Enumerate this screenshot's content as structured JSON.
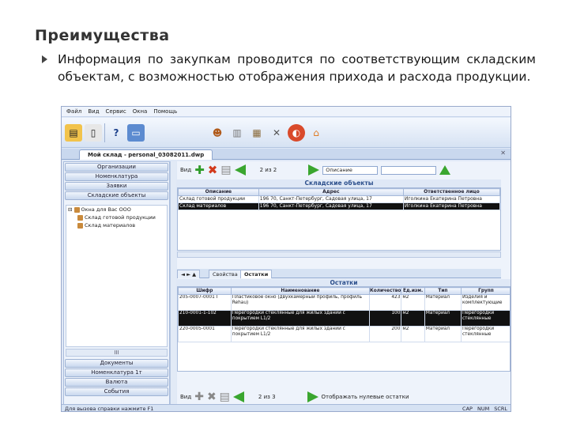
{
  "slide": {
    "title": "Преимущества",
    "bullet": "Информация по закупкам проводится по соответствующим складским объектам, с возможностью отображения прихода и расхода продукции."
  },
  "app": {
    "menu": [
      "Файл",
      "Вид",
      "Сервис",
      "Окна",
      "Помощь"
    ],
    "doc_tab": "Мой склад - personal_03082011.dwp",
    "sidebar": {
      "top_buttons": [
        "Организации",
        "Номенклатура",
        "Заявки",
        "Складские объекты"
      ],
      "tree": [
        "Окна для Вас ООО",
        "Склад готовой продукции",
        "Склад материалов"
      ],
      "scroll_label": "III",
      "bottom_buttons": [
        "Документы",
        "Номенклатура 1т",
        "Валюта",
        "События"
      ]
    },
    "top_toolbar": {
      "view_label": "Вид",
      "page": "2 из 2",
      "filter": "Описание"
    },
    "objects_grid": {
      "title": "Складские объекты",
      "columns": [
        "Описание",
        "Адрес",
        "Ответственное лицо"
      ],
      "rows": [
        [
          "Склад готовой продукции",
          "196 70, Санкт-Петербург, Садовая улица, 17",
          "Иголкина Екатерина Петровна"
        ],
        [
          "Склад материалов",
          "196 70, Санкт-Петербург, Садовая улица, 17",
          "Иголкина Екатерина Петровна"
        ]
      ],
      "selected_row": 1
    },
    "subtabs": [
      "Свойства",
      "Остатки"
    ],
    "active_subtab": 1,
    "stock_grid": {
      "title": "Остатки",
      "columns": [
        "Шифр",
        "Наименование",
        "Количество",
        "Ед.изм.",
        "Тип",
        "Групп"
      ],
      "rows": [
        [
          "205-0007-0001 Г",
          "Пластиковое окно (двухкамерный профиль, профиль Rehau)",
          "423",
          "м2",
          "Материал",
          "Изделия и комплектующие"
        ],
        [
          "210-0001-1-102",
          "Перегородки стеклянные для жилых зданий с покрытием L1/2",
          "100",
          "м2",
          "Материал",
          "Перегородки стеклянные"
        ],
        [
          "220-0005-0001",
          "Перегородки стеклянные для жилых зданий с покрытием L1/2",
          "200",
          "м2",
          "Материал",
          "Перегородки стеклянные"
        ]
      ],
      "selected_row": 1
    },
    "bottom_toolbar": {
      "view_label": "Вид",
      "page": "2 из 3",
      "text": "Отображать нулевые остатки"
    },
    "status": {
      "hint": "Для вызова справки нажмите F1",
      "indicators": [
        "CAP",
        "NUM",
        "SCRL"
      ]
    }
  }
}
